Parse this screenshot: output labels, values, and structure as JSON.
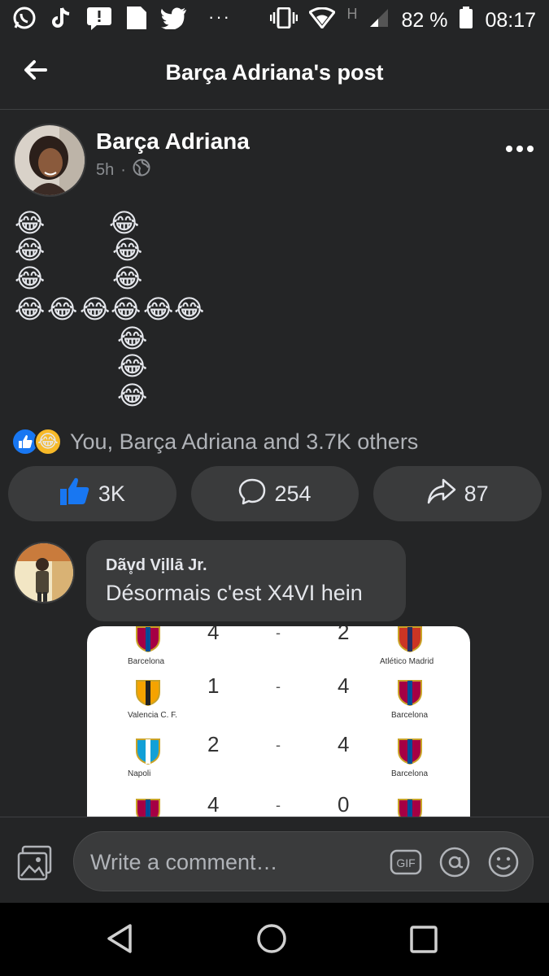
{
  "status_bar": {
    "network_type": "H",
    "battery": "82 %",
    "time": "08:17",
    "icons": [
      "whatsapp-icon",
      "tiktok-icon",
      "message-icon",
      "file-icon",
      "twitter-icon",
      "more-notifications-icon",
      "vibrate-icon",
      "wifi-icon",
      "signal-icon",
      "battery-icon"
    ]
  },
  "header": {
    "title": "Barça Adriana's post"
  },
  "post": {
    "author": "Barça Adriana",
    "time": "5h",
    "separator": "·",
    "privacy_icon": "globe-icon",
    "emoji": "😂",
    "reactions_text": "You, Barça Adriana and 3.7K others",
    "like_count": "3K",
    "comment_count": "254",
    "share_count": "87"
  },
  "comment": {
    "author": "Dãv̥d Vịllā Jr.",
    "text": "Désormais c'est X4VI hein",
    "results": [
      {
        "home_team": "Barcelona",
        "home_score": "4",
        "dash": "-",
        "away_score": "2",
        "away_team": "Atlético Madrid"
      },
      {
        "home_team": "Valencia C. F.",
        "home_score": "1",
        "dash": "-",
        "away_score": "4",
        "away_team": "Barcelona"
      },
      {
        "home_team": "Napoli",
        "home_score": "2",
        "dash": "-",
        "away_score": "4",
        "away_team": "Barcelona"
      },
      {
        "home_team": "",
        "home_score": "4",
        "dash": "-",
        "away_score": "0",
        "away_team": ""
      }
    ]
  },
  "comment_bar": {
    "placeholder": "Write a comment…",
    "gif_label": "GIF"
  },
  "colors": {
    "background": "#242526",
    "bubble": "#3a3b3c",
    "like_blue": "#1877f2",
    "haha_yellow": "#f7b928"
  }
}
